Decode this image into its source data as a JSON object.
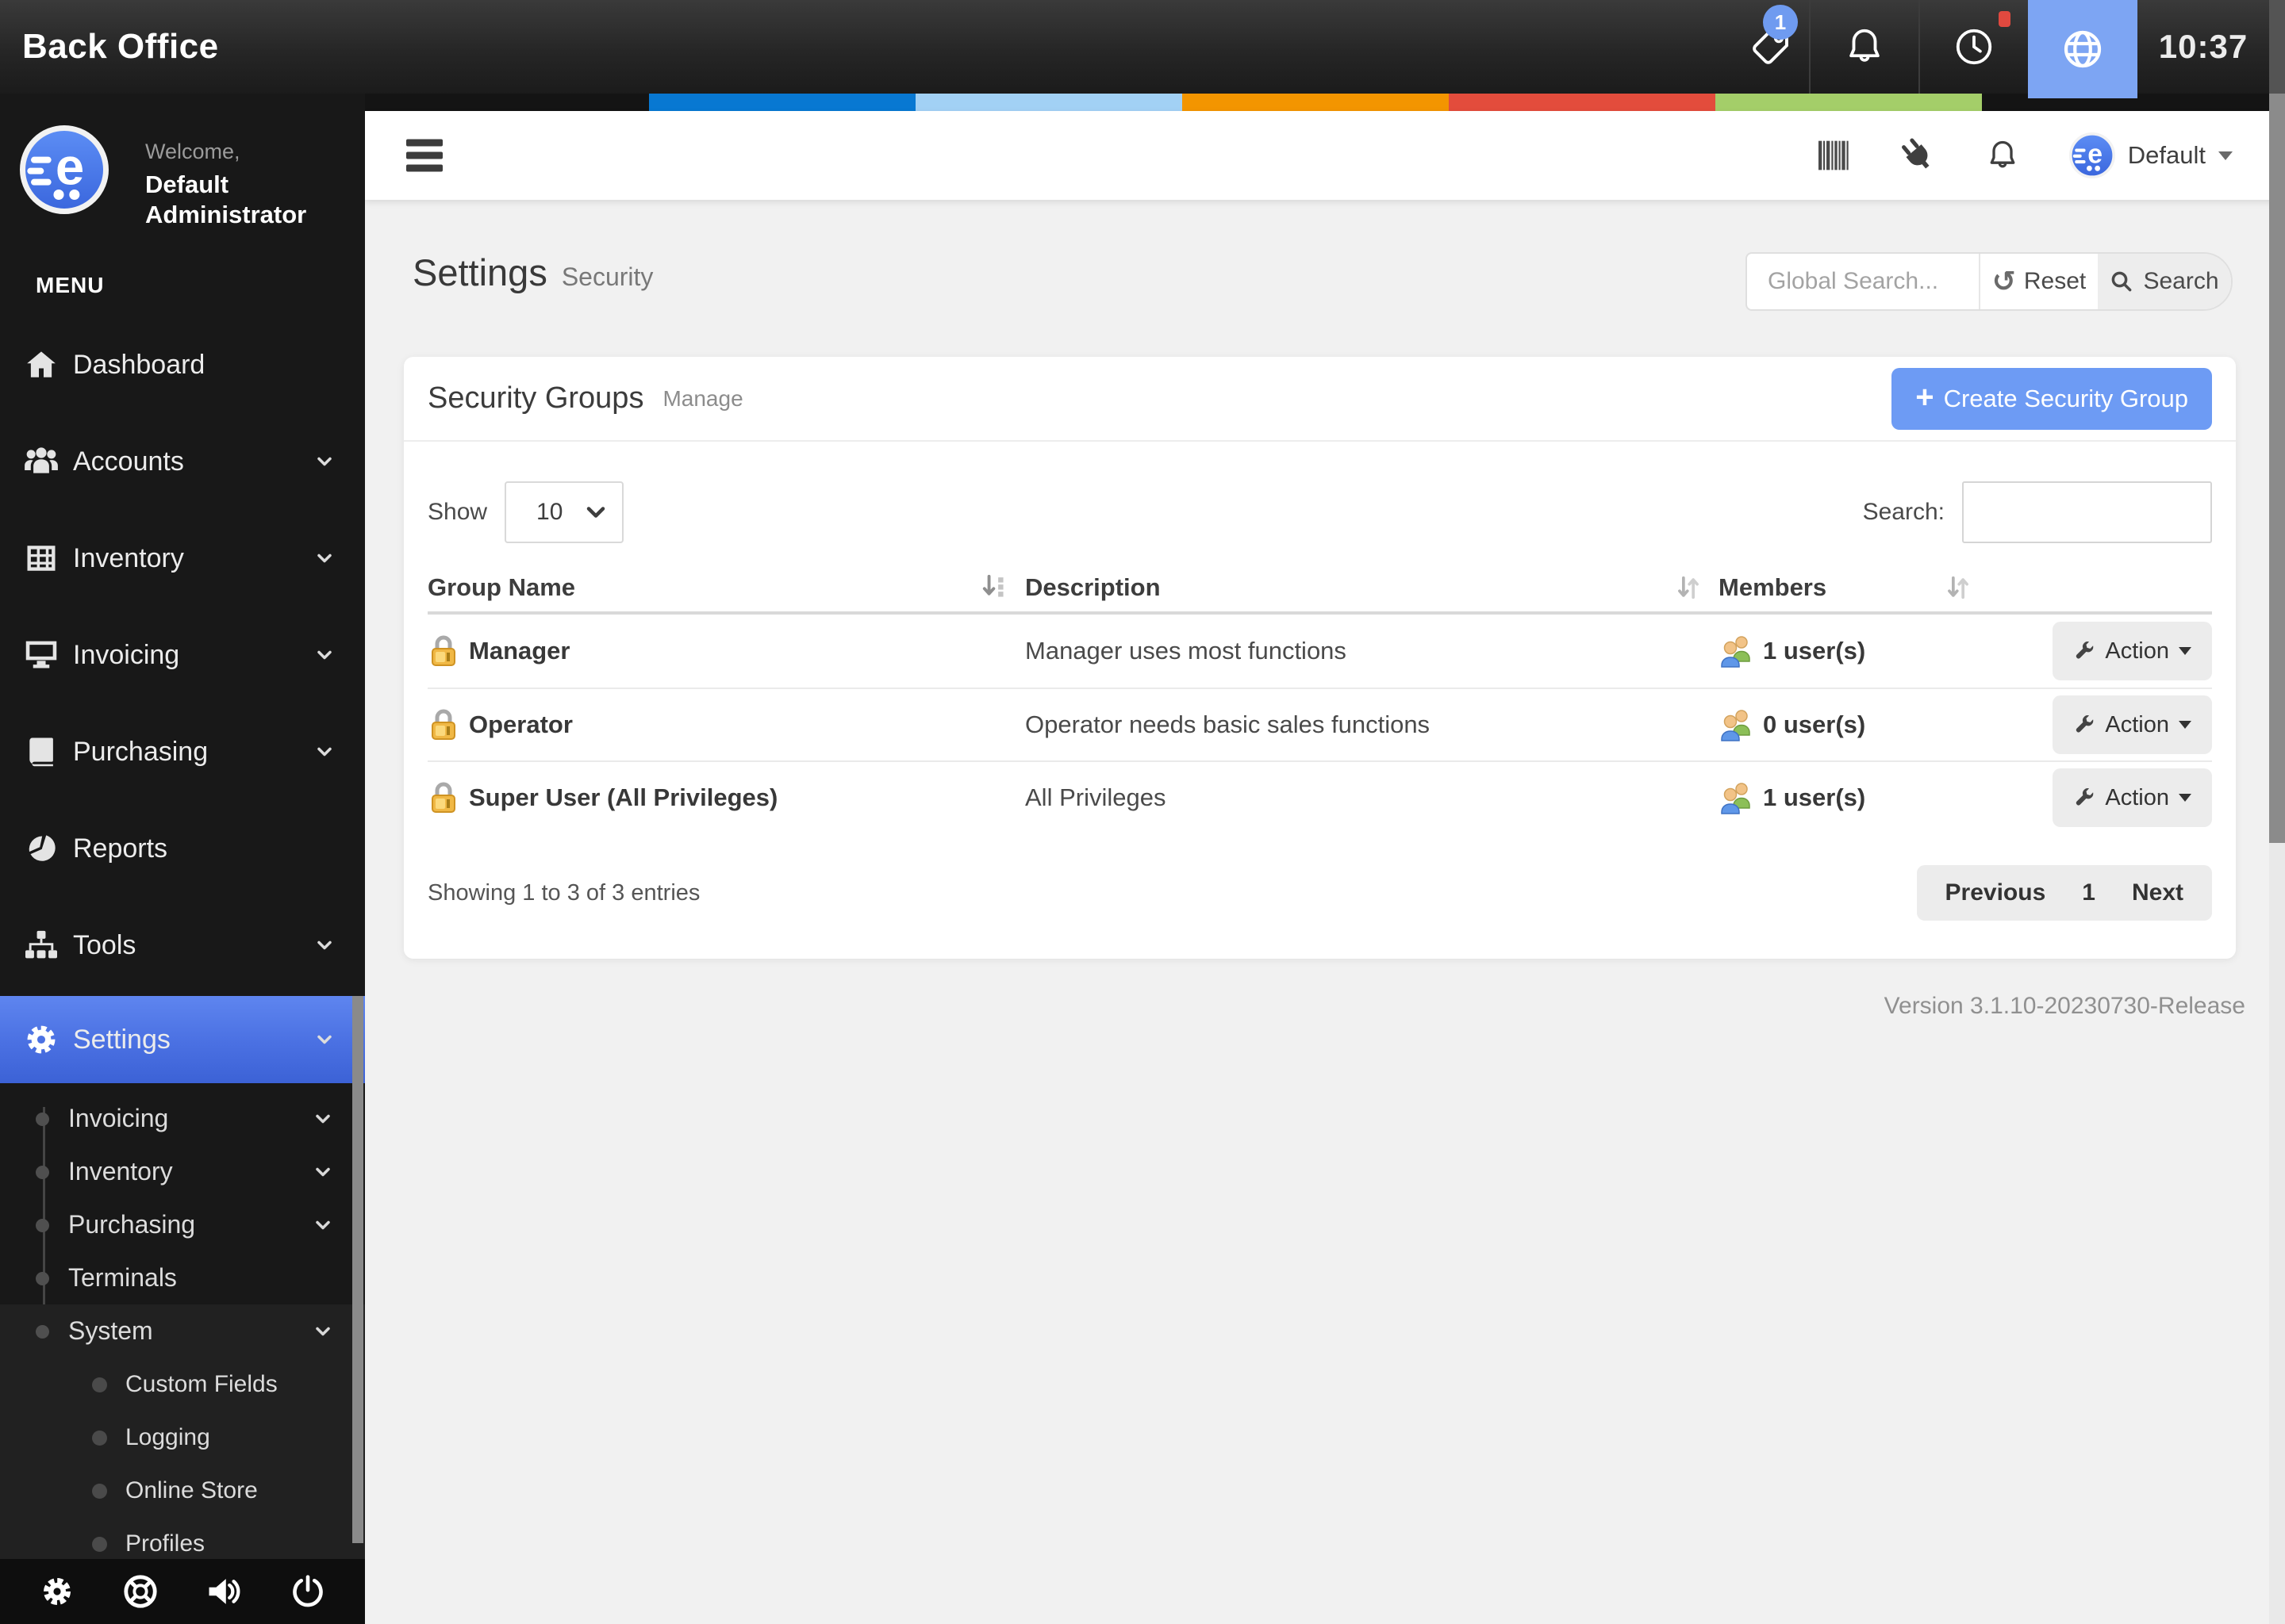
{
  "topbar": {
    "title": "Back Office",
    "time": "10:37",
    "tag_badge": "1"
  },
  "stripe": {
    "styles": {
      "s1": "background:#0878d2",
      "s2": "background:#a2d1f5",
      "s3": "background:#f39500",
      "s4": "background:#e34c3c",
      "s5": "background:#a4ce69"
    }
  },
  "sidebar": {
    "welcome": "Welcome,",
    "username": "Default Administrator",
    "menu_label": "MENU",
    "items": [
      {
        "label": "Dashboard"
      },
      {
        "label": "Accounts"
      },
      {
        "label": "Inventory"
      },
      {
        "label": "Invoicing"
      },
      {
        "label": "Purchasing"
      },
      {
        "label": "Reports"
      },
      {
        "label": "Tools"
      }
    ],
    "settings_label": "Settings",
    "settings_children": [
      {
        "label": "Invoicing"
      },
      {
        "label": "Inventory"
      },
      {
        "label": "Purchasing"
      },
      {
        "label": "Terminals"
      },
      {
        "label": "System"
      }
    ],
    "system_children": [
      {
        "label": "Custom Fields"
      },
      {
        "label": "Logging"
      },
      {
        "label": "Online Store"
      },
      {
        "label": "Profiles"
      }
    ]
  },
  "header": {
    "profile_name": "Default"
  },
  "page": {
    "title": "Settings",
    "subtitle": "Security",
    "version": "Version 3.1.10-20230730-Release"
  },
  "global_search": {
    "placeholder": "Global Search...",
    "reset_label": "Reset",
    "search_label": "Search"
  },
  "card": {
    "title": "Security Groups",
    "subtitle": "Manage",
    "create_label": "Create Security Group",
    "show_label": "Show",
    "page_size": "10",
    "search_label": "Search:",
    "columns": {
      "name": "Group Name",
      "description": "Description",
      "members": "Members"
    },
    "rows": [
      {
        "name": "Manager",
        "description": "Manager uses most functions",
        "members": "1 user(s)",
        "action": "Action"
      },
      {
        "name": "Operator",
        "description": "Operator needs basic sales functions",
        "members": "0 user(s)",
        "action": "Action"
      },
      {
        "name": "Super User (All Privileges)",
        "description": "All Privileges",
        "members": "1 user(s)",
        "action": "Action"
      }
    ],
    "footer": "Showing 1 to 3 of 3 entries",
    "pagination": {
      "previous": "Previous",
      "current": "1",
      "next": "Next"
    }
  },
  "colors": {
    "accent_blue": "#6d9bf4",
    "active_nav_gradient_top": "#5e85ef",
    "active_nav_gradient_bottom": "#3c62d6",
    "topbar_highlight": "#7da5f3",
    "lock_gold": "#efb73e"
  }
}
